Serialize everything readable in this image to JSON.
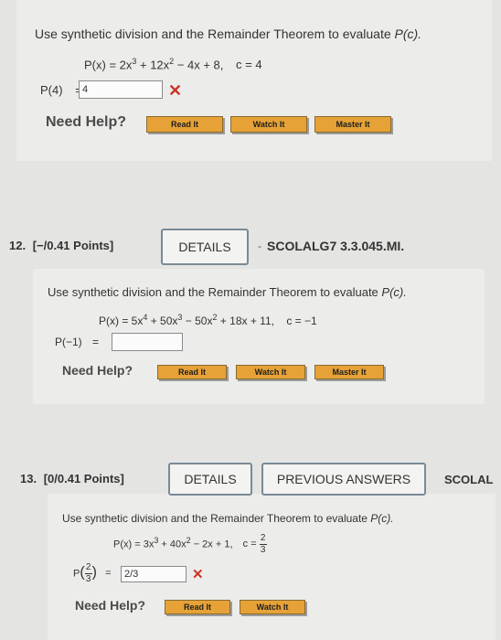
{
  "q11": {
    "prompt_prefix": "Use synthetic division and the Remainder Theorem to evaluate ",
    "prompt_func": "P(c).",
    "poly_a": "P(x) = 2x",
    "poly_b": " + 12x",
    "poly_c": " − 4x + 8,",
    "exp3": "3",
    "exp2": "2",
    "c_eq": "c = 4",
    "answer_label": "P(4)",
    "equals": "=",
    "answer_value": "4",
    "need_help": "Need Help?",
    "read_it": "Read It",
    "watch_it": "Watch It",
    "master_it": "Master It"
  },
  "q12": {
    "number": "12.",
    "points": "[−/0.41 Points]",
    "details": "DETAILS",
    "code_dash": "-",
    "code": "SCOLALG7 3.3.045.MI.",
    "prompt_prefix": "Use synthetic division and the Remainder Theorem to evaluate ",
    "prompt_func": "P(c).",
    "poly_a": "P(x) = 5x",
    "exp4": "4",
    "poly_b": " + 50x",
    "exp3": "3",
    "poly_c": " − 50x",
    "exp2": "2",
    "poly_d": " + 18x + 11,",
    "c_eq": "c = −1",
    "answer_label": "P(−1)",
    "equals": "=",
    "answer_value": "",
    "need_help": "Need Help?",
    "read_it": "Read It",
    "watch_it": "Watch It",
    "master_it": "Master It"
  },
  "q13": {
    "number": "13.",
    "points": "[0/0.41 Points]",
    "details": "DETAILS",
    "previous_answers": "PREVIOUS ANSWERS",
    "code_partial": "SCOLAL",
    "prompt_prefix": "Use synthetic division and the Remainder Theorem to evaluate ",
    "prompt_func": "P(c).",
    "poly_a": "P(x) = 3x",
    "exp3": "3",
    "poly_b": " + 40x",
    "exp2": "2",
    "poly_c": " − 2x + 1,",
    "c_prefix": "c =",
    "frac_num": "2",
    "frac_den": "3",
    "p_label": "P",
    "equals": "=",
    "answer_value": "2/3",
    "need_help": "Need Help?",
    "read_it": "Read It",
    "watch_it": "Watch It"
  },
  "colors": {
    "help_button": "#e6a237",
    "error_x": "#c9342a",
    "background": "#e4e5e3"
  },
  "icons": [
    "incorrect-x-icon"
  ]
}
